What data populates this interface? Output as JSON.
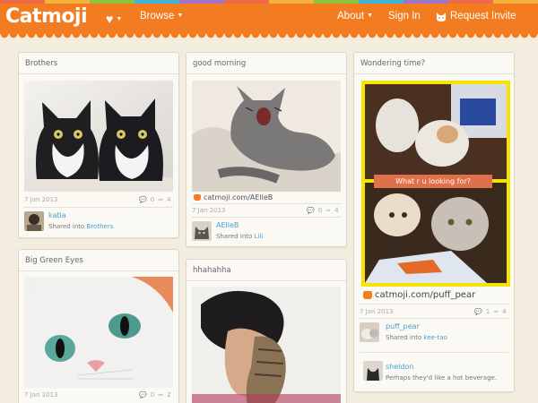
{
  "header": {
    "logo": "Catmoji",
    "browse_label": "Browse",
    "about_label": "About",
    "signin_label": "Sign In",
    "request_label": "Request Invite",
    "colors": {
      "accent": "#f47c20",
      "background": "#f3ede0",
      "link": "#4a9fd0"
    },
    "rainbow": [
      "#f06a4a",
      "#f6b23c",
      "#8cc63f",
      "#3fb6d8",
      "#9f73c5",
      "#f06a4a",
      "#f6b23c",
      "#8cc63f",
      "#3fb6d8",
      "#9f73c5",
      "#f06a4a",
      "#f6b23c"
    ]
  },
  "cards": {
    "brothers": {
      "title": "Brothers",
      "date": "7 Jan 2013",
      "comments": "0",
      "shares": "4",
      "user": "katia",
      "shared_prefix": "Shared into",
      "shared_into": "Brothers"
    },
    "good_morning": {
      "title": "good morning",
      "source": "catmoji.com/AElleB",
      "date": "7 Jan 2013",
      "comments": "0",
      "shares": "4",
      "user": "AElleB",
      "shared_prefix": "Shared into",
      "shared_into": "Lili"
    },
    "wondering": {
      "title": "Wondering time?",
      "caption": "What r u looking for?",
      "source": "catmoji.com/puff_pear",
      "date": "7 Jan 2013",
      "comments": "1",
      "shares": "4",
      "user": "puff_pear",
      "shared_prefix": "Shared into",
      "shared_into": "kee-tao",
      "commenter": "sheldon",
      "comment": "Perhaps they'd like a hot beverage."
    },
    "green_eyes": {
      "title": "Big Green Eyes",
      "date": "7 Jan 2013",
      "comments": "0",
      "shares": "2"
    },
    "hhahahha": {
      "title": "hhahahha"
    }
  }
}
